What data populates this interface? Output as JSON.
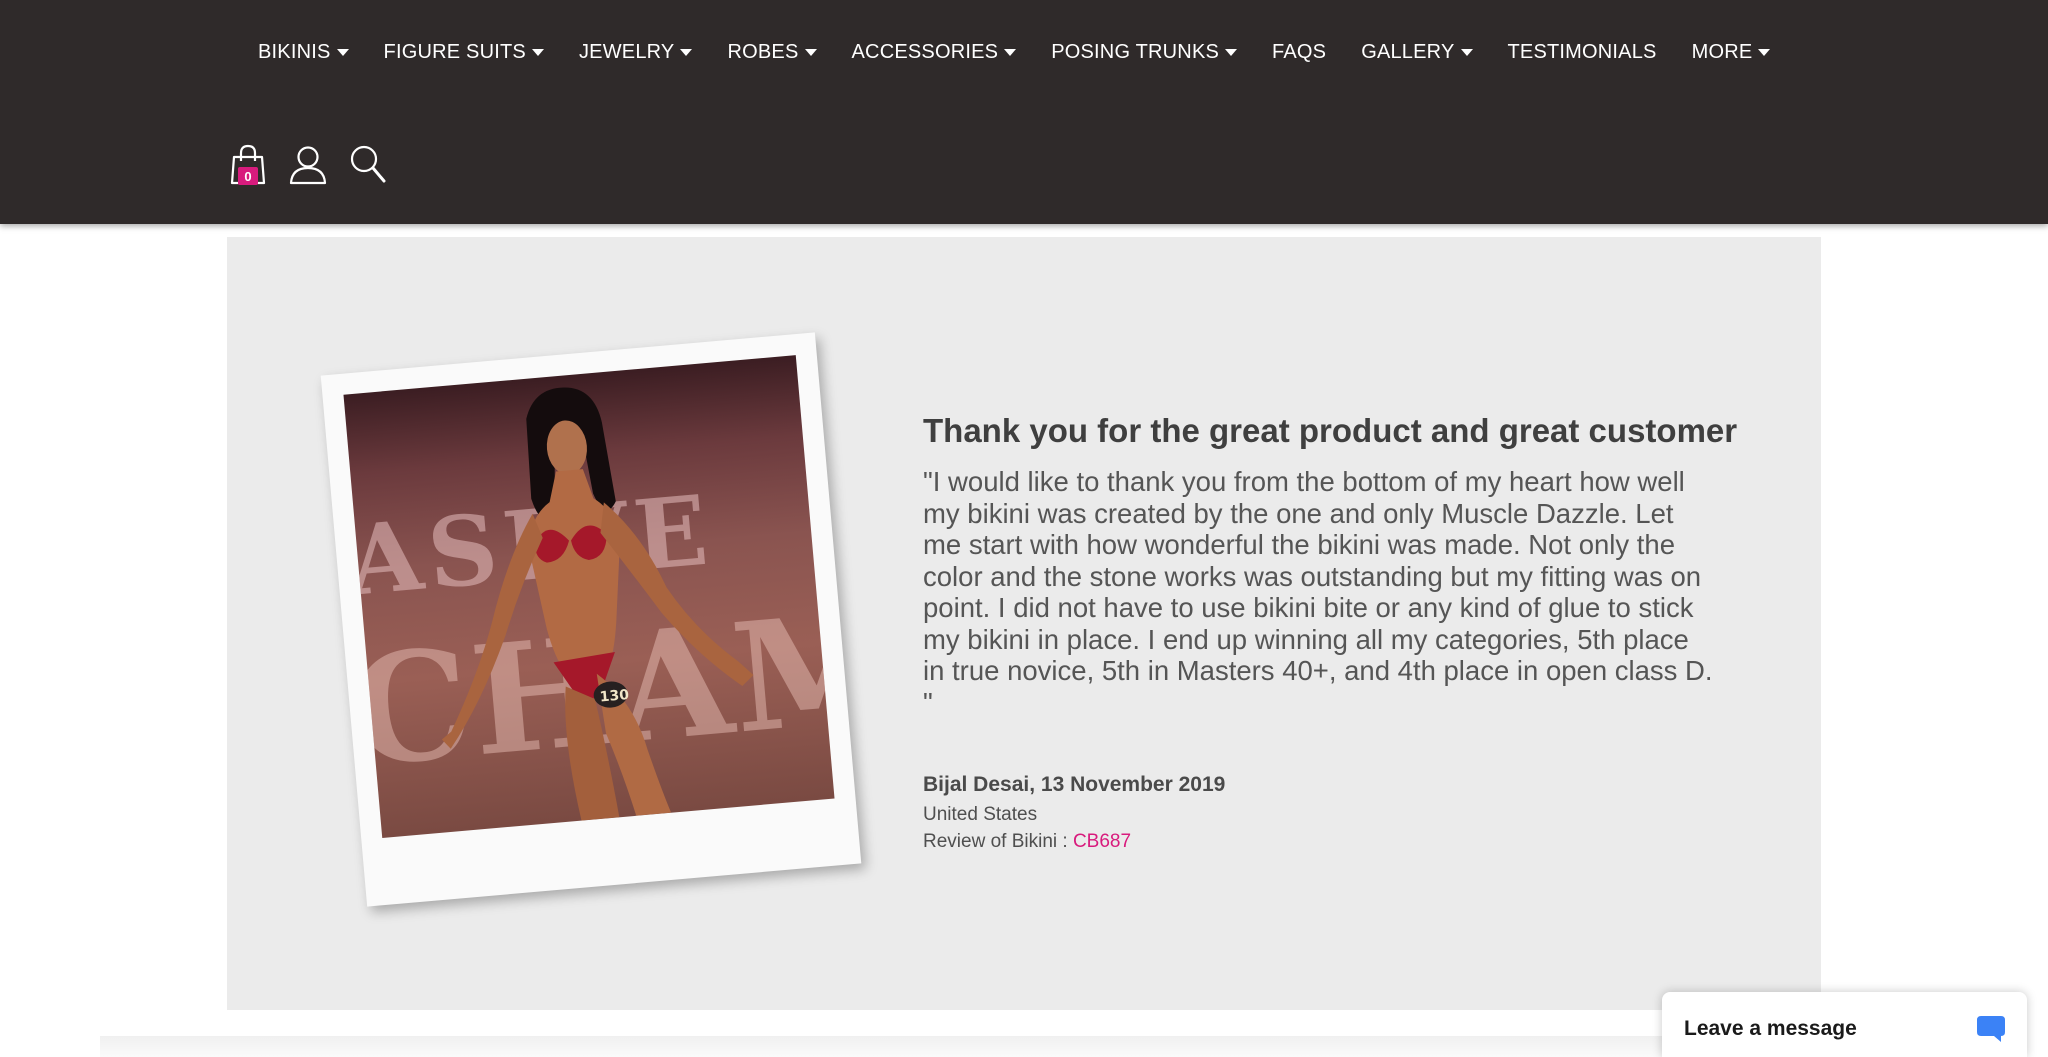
{
  "nav": {
    "items": [
      {
        "label": "BIKINIS",
        "dropdown": true
      },
      {
        "label": "FIGURE SUITS",
        "dropdown": true
      },
      {
        "label": "JEWELRY",
        "dropdown": true
      },
      {
        "label": "ROBES",
        "dropdown": true
      },
      {
        "label": "ACCESSORIES",
        "dropdown": true
      },
      {
        "label": "POSING TRUNKS",
        "dropdown": true
      },
      {
        "label": "FAQS",
        "dropdown": false
      },
      {
        "label": "GALLERY",
        "dropdown": true
      },
      {
        "label": "TESTIMONIALS",
        "dropdown": false
      },
      {
        "label": "MORE",
        "dropdown": true
      }
    ]
  },
  "header_icons": {
    "cart_icon": "shopping-bag-icon",
    "cart_count": "0",
    "account_icon": "user-icon",
    "search_icon": "search-icon"
  },
  "testimonial": {
    "title": "Thank you for the great product and great customer",
    "body": "\"I would like to thank you from the bottom of my heart how well my bikini was created by the one and only Muscle Dazzle. Let me start with how wonderful the bikini was made. Not only the color and the stone works was outstanding but my fitting was on point. I did not have to use bikini bite or any kind of glue to stick my bikini in place. I end up winning all my categories, 5th place in true novice, 5th in Masters 40+, and 4th place in open class D. \"",
    "author_date": "Bijal Desai, 13 November 2019",
    "country": "United States",
    "product_prefix": "Review of Bikini : ",
    "product_code": "CB687",
    "photo_banner_text_1": "ASIVE",
    "photo_banner_text_2": "CHAMP",
    "photo_bib_number": "130"
  },
  "chat": {
    "label": "Leave a message",
    "icon": "chat-bubble-icon"
  },
  "colors": {
    "header_bg": "#2f2a2a",
    "accent_pink": "#d81b7d",
    "panel_bg": "#ebebeb",
    "chat_icon": "#3b82f6"
  }
}
